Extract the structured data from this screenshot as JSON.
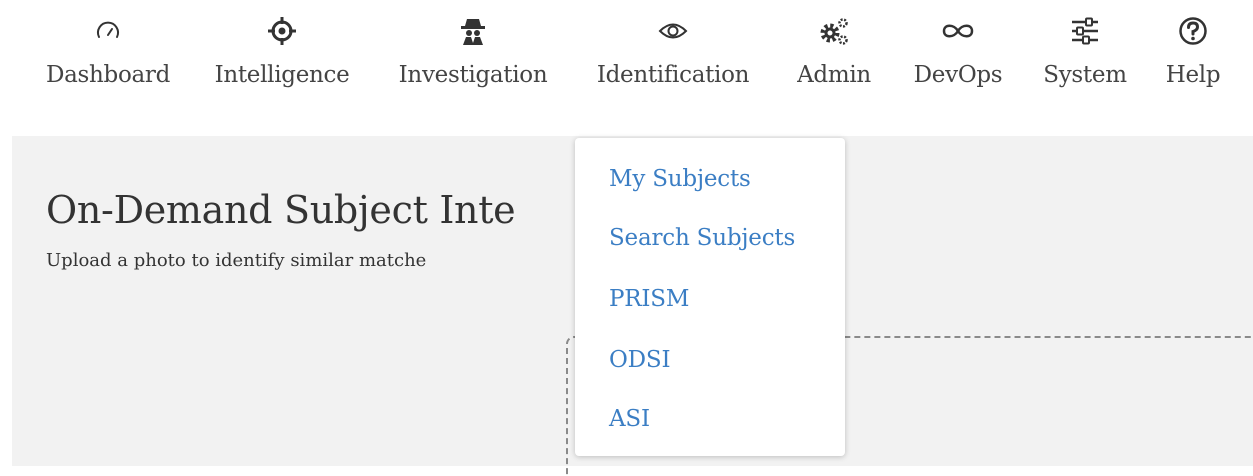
{
  "nav": {
    "items": [
      {
        "label": "Dashboard",
        "icon": "speedometer-icon"
      },
      {
        "label": "Intelligence",
        "icon": "crosshair-icon"
      },
      {
        "label": "Investigation",
        "icon": "spy-icon"
      },
      {
        "label": "Identification",
        "icon": "eye-icon"
      },
      {
        "label": "Admin",
        "icon": "gears-icon"
      },
      {
        "label": "DevOps",
        "icon": "infinity-icon"
      },
      {
        "label": "System",
        "icon": "sliders-icon"
      },
      {
        "label": "Help",
        "icon": "question-icon"
      }
    ]
  },
  "page": {
    "title": "On-Demand Subject Inte",
    "subtitle": "Upload a photo to identify similar matche"
  },
  "dropdown": {
    "items": [
      "My Subjects",
      "Search Subjects",
      "PRISM",
      "ODSI",
      "ASI"
    ]
  },
  "colors": {
    "link": "#3b7ec4",
    "nav_text": "#444444",
    "content_bg": "#f2f2f2"
  }
}
